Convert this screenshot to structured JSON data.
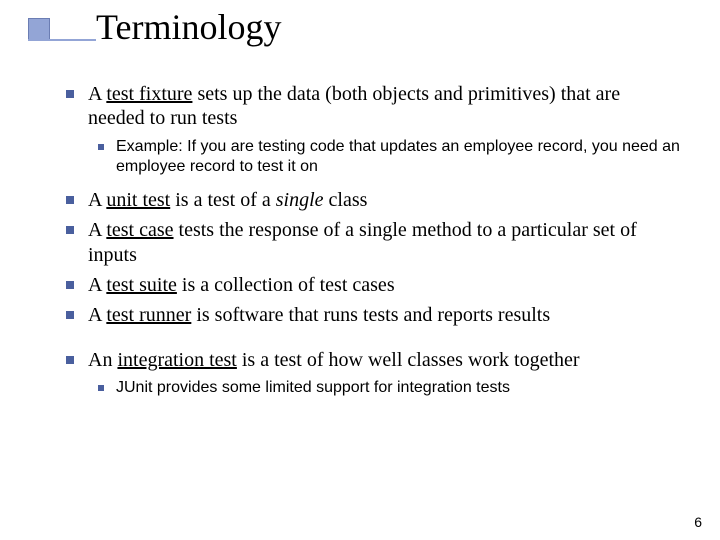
{
  "title": "Terminology",
  "b1_a": "A ",
  "b1_term": "test fixture",
  "b1_b": " sets up the data (both objects and primitives) that are needed to run tests",
  "b1_sub": "Example: If you are testing code that updates an employee record, you need an employee record to test it on",
  "b2_a": "A ",
  "b2_term": "unit test",
  "b2_b": " is a test of a ",
  "b2_em": "single",
  "b2_c": " class",
  "b3_a": "A ",
  "b3_term": "test case",
  "b3_b": " tests the response of a single method to a particular set of inputs",
  "b4_a": "A ",
  "b4_term": "test suite",
  "b4_b": " is a collection of test cases",
  "b5_a": "A ",
  "b5_term": "test runner",
  "b5_b": " is software that runs tests and reports results",
  "b6_a": "An ",
  "b6_term": "integration test",
  "b6_b": " is a test of how well classes work together",
  "b6_sub": "JUnit provides some limited support for integration tests",
  "page_number": "6"
}
